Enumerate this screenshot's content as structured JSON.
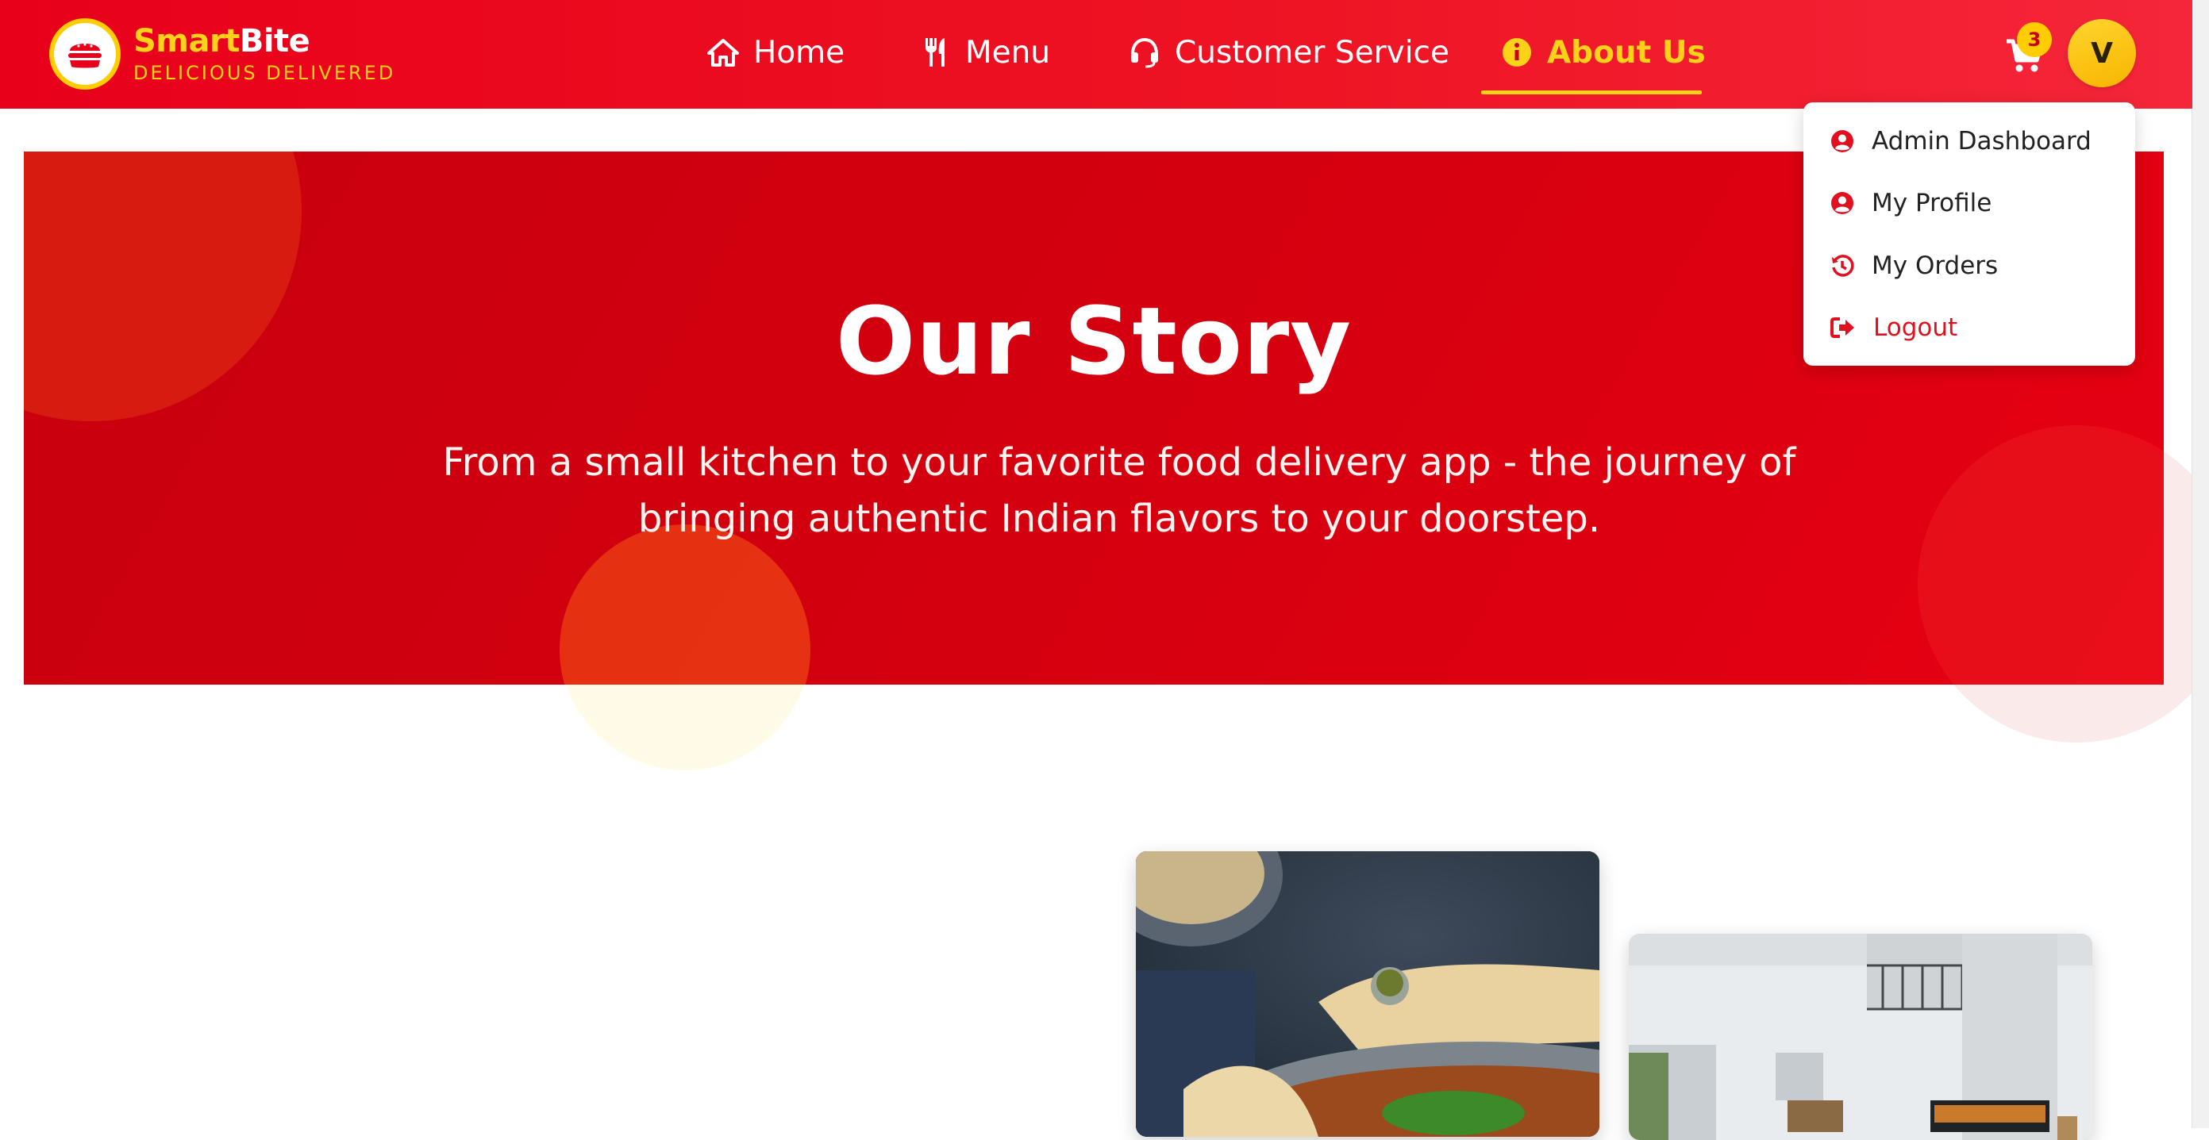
{
  "brand": {
    "name_part1": "Smart",
    "name_part2": "Bite",
    "tagline": "DELICIOUS DELIVERED"
  },
  "nav": {
    "items": [
      {
        "label": "Home",
        "icon": "home-icon"
      },
      {
        "label": "Menu",
        "icon": "utensils-icon"
      },
      {
        "label": "Customer Service",
        "icon": "headset-icon"
      },
      {
        "label": "About Us",
        "icon": "info-icon",
        "active": true
      }
    ]
  },
  "cart": {
    "count": "3",
    "icon": "cart-icon"
  },
  "user": {
    "initial": "V"
  },
  "dropdown": {
    "items": [
      {
        "label": "Admin Dashboard",
        "icon": "user-circle-icon"
      },
      {
        "label": "My Profile",
        "icon": "user-circle-icon"
      },
      {
        "label": "My Orders",
        "icon": "history-icon"
      },
      {
        "label": "Logout",
        "icon": "logout-icon"
      }
    ]
  },
  "hero": {
    "title": "Our Story",
    "subtitle": "From a small kitchen to your favorite food delivery app - the journey of bringing authentic Indian flavors to your doorstep."
  },
  "colors": {
    "primary_red": "#e8001a",
    "accent_yellow": "#ffd21a",
    "hero_red": "#d0000f"
  }
}
